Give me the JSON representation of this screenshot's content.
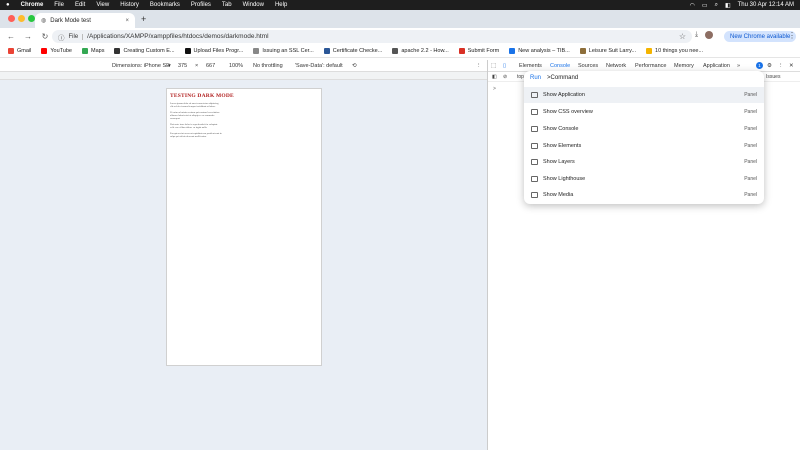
{
  "menubar": {
    "apple_icon": "apple-icon",
    "app_name": "Chrome",
    "items": [
      "File",
      "Edit",
      "View",
      "History",
      "Bookmarks",
      "Profiles",
      "Tab",
      "Window",
      "Help"
    ],
    "datetime": "Thu 30 Apr  12:14 AM"
  },
  "tab": {
    "title": "Dark Mode test",
    "close": "×",
    "new_tab": "+"
  },
  "toolbar": {
    "back": "←",
    "forward": "→",
    "reload": "↻",
    "chip_label": "File",
    "url": "/Applications/XAMPP/xamppfiles/htdocs/demos/darkmode.html",
    "star": "☆",
    "update_label": "New Chrome available"
  },
  "bookmarks": [
    {
      "label": "Gmail",
      "color": "#ea4335"
    },
    {
      "label": "YouTube",
      "color": "#ff0000"
    },
    {
      "label": "Maps",
      "color": "#34a853"
    },
    {
      "label": "Creating Custom E...",
      "color": "#333333"
    },
    {
      "label": "Upload Files Progr...",
      "color": "#111111"
    },
    {
      "label": "Issuing an SSL Cer...",
      "color": "#888888"
    },
    {
      "label": "Certificate Checke...",
      "color": "#2b5797"
    },
    {
      "label": "apache 2.2 - How...",
      "color": "#555555"
    },
    {
      "label": "Submit Form",
      "color": "#d93025"
    },
    {
      "label": "New analysis – TIB...",
      "color": "#1a73e8"
    },
    {
      "label": "Leisure Suit Larry...",
      "color": "#8d6e3a"
    },
    {
      "label": "10 things you nee...",
      "color": "#f4b400"
    }
  ],
  "device_toolbar": {
    "dimensions_label": "Dimensions: iPhone SE",
    "width": "375",
    "times": "×",
    "height": "667",
    "zoom": "100%",
    "throttling": "No throttling",
    "save_data": "'Save-Data': default"
  },
  "page": {
    "title": "TESTING DARK MODE",
    "paragraphs": [
      "Lorem ipsum dolor sit amet consectetur adipiscing elit sed do eiusmod tempor incididunt ut labore.",
      "Ut enim ad minim veniam quis nostrud exercitation ullamco laboris nisi ut aliquip ex ea commodo consequat.",
      "Duis aute irure dolor in reprehenderit in voluptate velit esse cillum dolore eu fugiat nulla.",
      "Excepteur sint occaecat cupidatat non proident sunt in culpa qui officia deserunt mollit anim."
    ]
  },
  "devtools": {
    "tabs": [
      "Elements",
      "Console",
      "Sources",
      "Network",
      "Performance",
      "Memory",
      "Application"
    ],
    "active_tab": "Console",
    "more": "»",
    "badge": "1",
    "sub_top": "top",
    "issues_label": "Issues",
    "console_prompt": ">"
  },
  "command_menu": {
    "run_label": "Run",
    "query": ">Command",
    "items": [
      {
        "label": "Show Application",
        "kind": "Panel"
      },
      {
        "label": "Show CSS overview",
        "kind": "Panel"
      },
      {
        "label": "Show Console",
        "kind": "Panel"
      },
      {
        "label": "Show Elements",
        "kind": "Panel"
      },
      {
        "label": "Show Layers",
        "kind": "Panel"
      },
      {
        "label": "Show Lighthouse",
        "kind": "Panel"
      },
      {
        "label": "Show Media",
        "kind": "Panel"
      }
    ]
  }
}
